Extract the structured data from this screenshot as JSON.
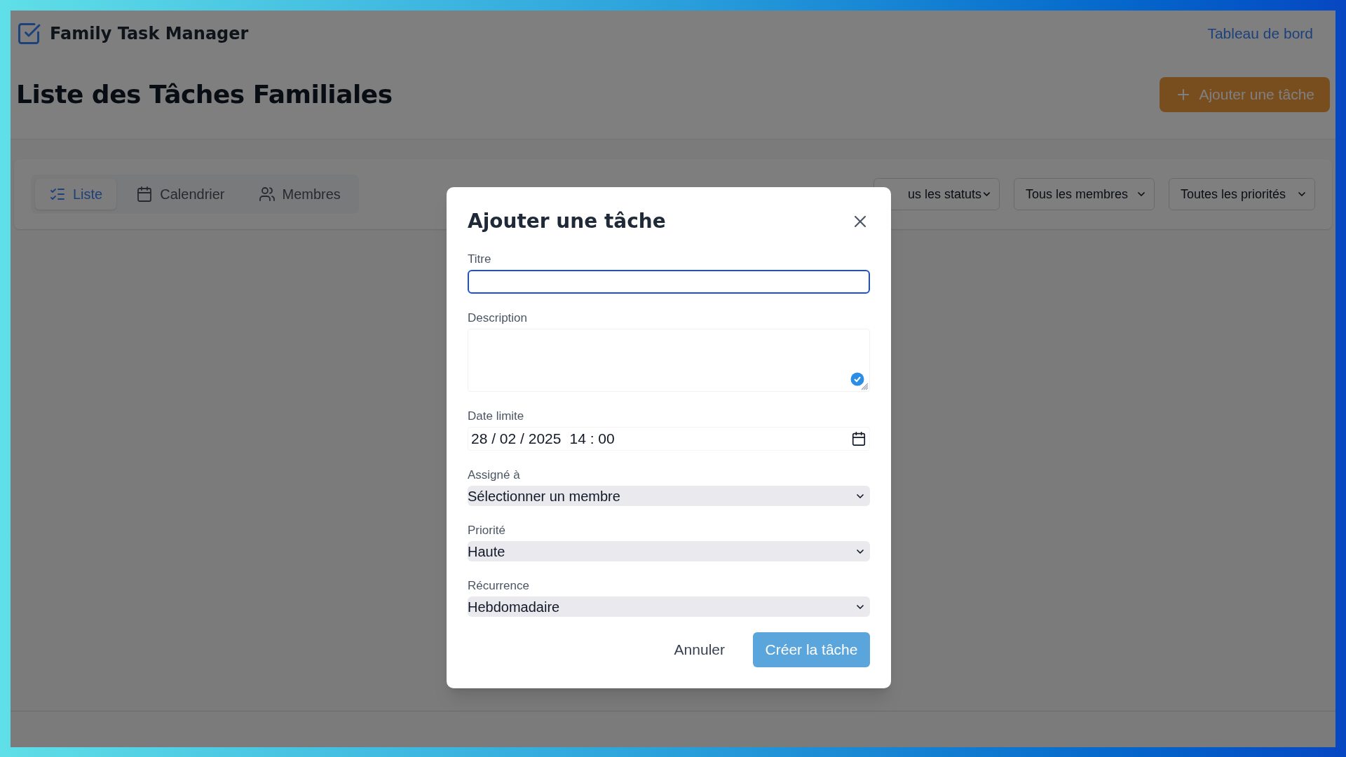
{
  "app": {
    "name": "Family Task Manager",
    "nav_link": "Tableau de bord"
  },
  "page": {
    "title": "Liste des Tâches Familiales",
    "add_button": "Ajouter une tâche"
  },
  "view_tabs": [
    {
      "label": "Liste",
      "selected": true
    },
    {
      "label": "Calendrier",
      "selected": false
    },
    {
      "label": "Membres",
      "selected": false
    }
  ],
  "filters": [
    "us les statuts",
    "Tous les membres",
    "Toutes les priorités"
  ],
  "dialog": {
    "title": "Ajouter une tâche",
    "fields": [
      {
        "kind": "text",
        "label": "Titre",
        "focused": true
      },
      {
        "kind": "textarea",
        "label": "Description"
      },
      {
        "kind": "datetime",
        "label": "Date limite",
        "date": "28 / 02 / 2025",
        "time": "14 : 00"
      },
      {
        "kind": "select",
        "label": "Assigné à",
        "value": "Sélectionner un membre"
      },
      {
        "kind": "select",
        "label": "Priorité",
        "value": "Haute"
      },
      {
        "kind": "select",
        "label": "Récurrence",
        "value": "Hebdomadaire"
      }
    ],
    "cancel": "Annuler",
    "submit": "Créer la tâche"
  }
}
